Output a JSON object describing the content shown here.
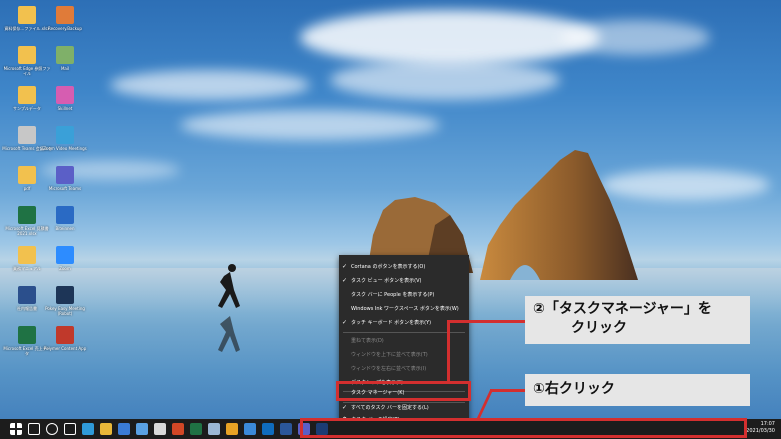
{
  "desktop_icons": [
    {
      "label": "資料保存…ファイル.xlsx",
      "color": "#f2c14e"
    },
    {
      "label": "Recovery.Backup",
      "color": "#e07b39"
    },
    {
      "label": "Microsoft Edge 参照ファイル",
      "color": "#f2c14e"
    },
    {
      "label": "Mail",
      "color": "#7fb069"
    },
    {
      "label": "サンプルデータ",
      "color": "#f2c14e"
    },
    {
      "label": "Skillnet",
      "color": "#d65db1"
    },
    {
      "label": "Microsoft Teams 会議メモ",
      "color": "#c7c7c7"
    },
    {
      "label": "Zoom Video Meetings",
      "color": "#3aa0d8"
    },
    {
      "label": "pdf",
      "color": "#f2c14e"
    },
    {
      "label": "Microsoft Teams",
      "color": "#5b5fc7"
    },
    {
      "label": "Microsoft Excel 見積書 2021.xlsx",
      "color": "#1f7244"
    },
    {
      "label": "Biteinnen",
      "color": "#2a6ac4"
    },
    {
      "label": "業務マニュアル",
      "color": "#f2c14e"
    },
    {
      "label": "Zoom",
      "color": "#2d8cff"
    },
    {
      "label": "社内報告書",
      "color": "#2b4f8c"
    },
    {
      "label": "Pokey Easy Meeting (Robot)",
      "color": "#1d3557"
    },
    {
      "label": "Microsoft Excel 売上データ",
      "color": "#1f7244"
    },
    {
      "label": "Polymer Content App",
      "color": "#c0392b"
    }
  ],
  "context_menu": {
    "items": [
      {
        "label": "Cortana のボタンを表示する(O)",
        "checked": true,
        "disabled": false
      },
      {
        "label": "タスク ビュー ボタンを表示(V)",
        "checked": true,
        "disabled": false
      },
      {
        "label": "タスク バーに People を表示する(P)",
        "checked": false,
        "disabled": false
      },
      {
        "label": "Windows Ink ワークスペース ボタンを表示(W)",
        "checked": false,
        "disabled": false
      },
      {
        "label": "タッチ キーボード ボタンを表示(Y)",
        "checked": true,
        "disabled": false
      },
      {
        "label": "重ねて表示(D)",
        "checked": false,
        "disabled": true
      },
      {
        "label": "ウィンドウを上下に並べて表示(T)",
        "checked": false,
        "disabled": true
      },
      {
        "label": "ウィンドウを左右に並べて表示(I)",
        "checked": false,
        "disabled": true
      },
      {
        "label": "デスクトップを表示(S)",
        "checked": false,
        "disabled": false
      },
      {
        "label": "タスク マネージャー(K)",
        "checked": false,
        "disabled": false
      },
      {
        "label": "すべてのタスク バーを固定する(L)",
        "checked": true,
        "disabled": false
      },
      {
        "label": "タスク バーの設定(T)",
        "checked": false,
        "disabled": false
      }
    ]
  },
  "taskbar": {
    "icons": [
      {
        "name": "start-icon",
        "color": "#ffffff"
      },
      {
        "name": "search-icon",
        "color": "#ffffff"
      },
      {
        "name": "cortana-icon",
        "color": "#ffffff"
      },
      {
        "name": "task-view-icon",
        "color": "#ffffff"
      },
      {
        "name": "edge-icon",
        "color": "#2f9ad8"
      },
      {
        "name": "file-explorer-icon",
        "color": "#e8b739"
      },
      {
        "name": "calendar-icon",
        "color": "#3a7bd5"
      },
      {
        "name": "store-icon",
        "color": "#5aa1e3"
      },
      {
        "name": "photos-icon",
        "color": "#d9d9d9"
      },
      {
        "name": "powerpoint-icon",
        "color": "#d24726"
      },
      {
        "name": "excel-icon",
        "color": "#1f7244"
      },
      {
        "name": "notepad-icon",
        "color": "#9bb7d4"
      },
      {
        "name": "chrome-icon",
        "color": "#e8a325"
      },
      {
        "name": "mail-icon",
        "color": "#3b8ad9"
      },
      {
        "name": "outlook-icon",
        "color": "#0f6cbd"
      },
      {
        "name": "word-icon",
        "color": "#2b579a"
      },
      {
        "name": "teams-icon",
        "color": "#5b5fc7"
      },
      {
        "name": "photoshop-icon",
        "color": "#1b3c73"
      }
    ],
    "clock": {
      "time": "17:07",
      "date": "2021/03/30"
    }
  },
  "annotations": {
    "step2": {
      "line1": "②「タスクマネージャー」を",
      "line2": "クリック"
    },
    "step1": {
      "label": "①右クリック"
    },
    "highlight_color": "#d32f2f"
  }
}
